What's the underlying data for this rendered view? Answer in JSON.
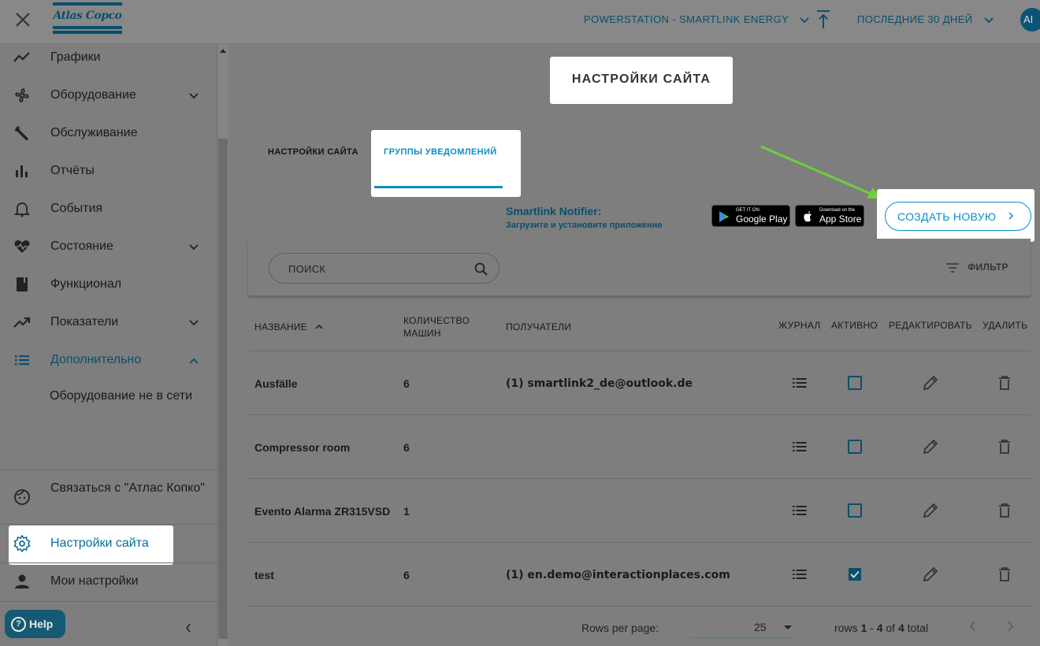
{
  "header": {
    "logo_text": "Atlas Copco",
    "site": "POWERSTATION - SMARTLINK ENERGY",
    "period": "ПОСЛЕДНИЕ 30 ДНЕЙ",
    "avatar": "AI"
  },
  "sidebar": {
    "items": [
      {
        "label": "Графики"
      },
      {
        "label": "Оборудование"
      },
      {
        "label": "Обслуживание"
      },
      {
        "label": "Отчёты"
      },
      {
        "label": "События"
      },
      {
        "label": "Состояние"
      },
      {
        "label": "Функционал"
      },
      {
        "label": "Показатели"
      },
      {
        "label": "Дополнительно"
      }
    ],
    "sub_item": "Оборудование не в сети",
    "contact": "Связаться с \"Атлас Копко\"",
    "site_settings": "Настройки сайта",
    "my_settings": "Мои настройки",
    "help": "Help"
  },
  "main": {
    "page_title": "НАСТРОЙКИ САЙТА",
    "tabs": [
      {
        "label": "НАСТРОЙКИ САЙТА"
      },
      {
        "label": "ГРУППЫ УВЕДОМЛЕНИЙ"
      }
    ],
    "notifier_title": "Smartlink Notifier:",
    "notifier_sub": "Загрузите и установите приложение",
    "google_play_top": "GET IT ON",
    "google_play": "Google Play",
    "app_store_top": "Download on the",
    "app_store": "App Store",
    "create_button": "СОЗДАТЬ НОВУЮ",
    "search_placeholder": "ПОИСК",
    "filter": "ФИЛЬТР"
  },
  "table": {
    "headers": {
      "name": "НАЗВАНИЕ",
      "machines": "КОЛИЧЕСТВО МАШИН",
      "recipients": "ПОЛУЧАТЕЛИ",
      "journal": "ЖУРНАЛ",
      "active": "АКТИВНО",
      "edit": "РЕДАКТИРОВАТЬ",
      "delete": "УДАЛИТЬ"
    },
    "rows": [
      {
        "name": "Ausfälle",
        "machines": "6",
        "recipients": "(1) smartlink2_de@outlook.de",
        "active": false
      },
      {
        "name": "Compressor room",
        "machines": "6",
        "recipients": "",
        "active": false
      },
      {
        "name": "Evento Alarma ZR315VSD",
        "machines": "1",
        "recipients": "",
        "active": false
      },
      {
        "name": "test",
        "machines": "6",
        "recipients": "(1) en.demo@interactionplaces.com",
        "active": true
      }
    ]
  },
  "pagination": {
    "rows_per_page_label": "Rows per page:",
    "rows_per_page": "25",
    "rows_word": "rows",
    "from": "1",
    "to": "4",
    "of_word": "of",
    "total": "4",
    "total_word": "total"
  },
  "colors": {
    "accent": "#0a8fc4",
    "brand": "#0a4f6b",
    "overlay": "#7e7e7e",
    "arrow": "#6fcf3a"
  }
}
